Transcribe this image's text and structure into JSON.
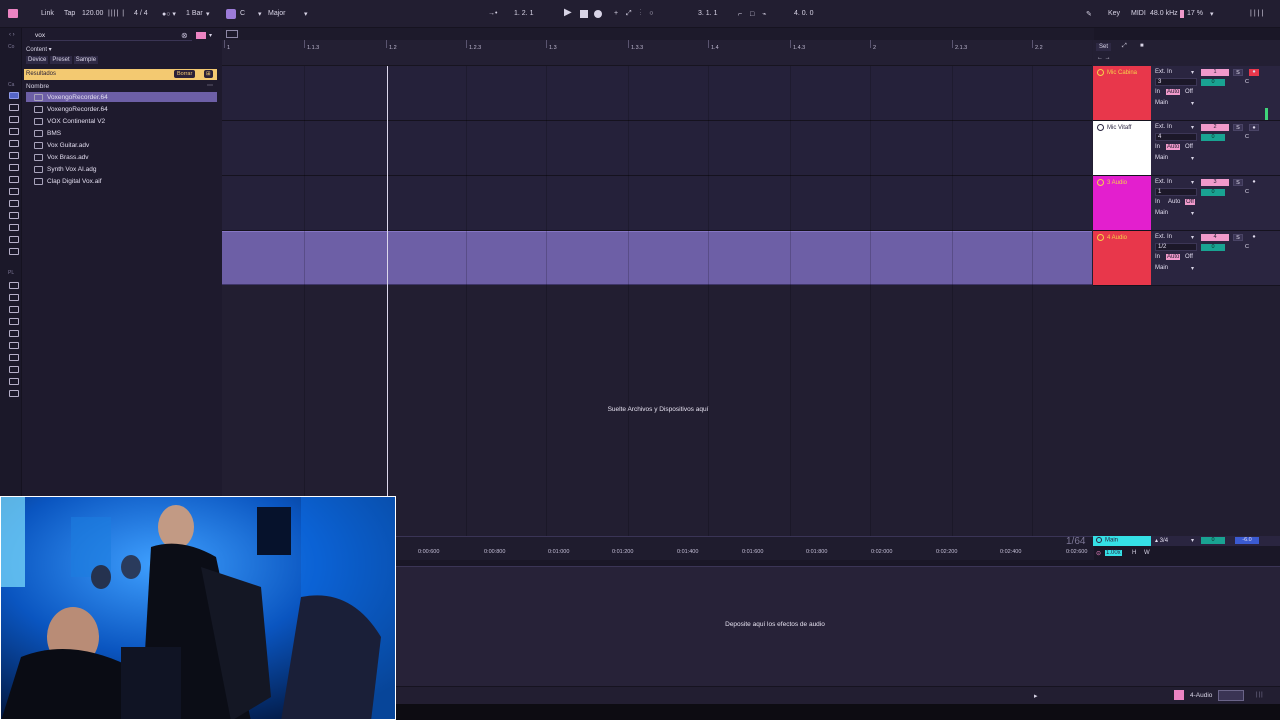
{
  "topbar": {
    "link": "Link",
    "tap": "Tap",
    "tempo": "120.00",
    "time_sig": "4 / 4",
    "quantize": "1 Bar",
    "key_root": "C",
    "scale": "Major",
    "arrangement_position": "1.   2.   1",
    "loop_start": "3.   1.   1",
    "loop_length": "4.   0.   0",
    "key_label": "Key",
    "midi_label": "MIDI",
    "sample_rate": "48.0 kHz",
    "cpu": "17 %"
  },
  "browser": {
    "search_value": "vox",
    "content_label": "Content",
    "filters": [
      "Device",
      "Preset",
      "Sample"
    ],
    "results_label": "Resultados",
    "clear_label": "Borrar",
    "column_header": "Nombre",
    "files": [
      "VoxengoRecorder.64",
      "VoxengoRecorder.64",
      "VOX Continental V2",
      "BMS",
      "Vox Guitar.adv",
      "Vox Brass.adv",
      "Synth Vox AI.adg",
      "Clap Digital Vox.aif"
    ],
    "side_labels": [
      "Co",
      "Ca",
      "PL"
    ]
  },
  "ruler": {
    "ticks": [
      "1",
      "1.1.3",
      "1.2",
      "1.2.3",
      "1.3",
      "1.3.3",
      "1.4",
      "1.4.3",
      "2",
      "2.1.3",
      "2.2"
    ]
  },
  "arrangement": {
    "drop_message": "Suelte Archivos y Dispositivos aquí",
    "zoom_label": "1/64",
    "timeline": [
      "0:00:600",
      "0:00:800",
      "0:01:000",
      "0:01:200",
      "0:01:400",
      "0:01:600",
      "0:01:800",
      "0:02:000",
      "0:02:200",
      "0:02:400",
      "0:02:600"
    ]
  },
  "mixer_header": {
    "set_label": "Set"
  },
  "tracks": [
    {
      "name": "Mic Cabina",
      "color": "#e8374b",
      "text_color": "#f5d14a",
      "input": "Ext. In",
      "channel": "3",
      "number": "1",
      "in": "In",
      "auto": "Auto",
      "off": "Off",
      "out": "Main",
      "solo": "S",
      "vol": "0",
      "pan": "C"
    },
    {
      "name": "Mic Vitaff",
      "color": "#ffffff",
      "text_color": "#2a2540",
      "input": "Ext. In",
      "channel": "4",
      "number": "2",
      "in": "In",
      "auto": "Auto",
      "off": "Off",
      "out": "Main",
      "solo": "S",
      "vol": "0",
      "pan": "C"
    },
    {
      "name": "3 Audio",
      "color": "#e31fce",
      "text_color": "#f5d14a",
      "input": "Ext. In",
      "channel": "1",
      "number": "3",
      "in": "In",
      "auto": "Auto",
      "off": "Off",
      "out": "Main",
      "solo": "S",
      "vol": "0",
      "pan": "C"
    },
    {
      "name": "4 Audio",
      "color": "#e8374b",
      "text_color": "#f5d14a",
      "input": "Ext. In",
      "channel": "1/2",
      "number": "4",
      "in": "In",
      "auto": "Auto",
      "off": "Off",
      "out": "Main",
      "solo": "S",
      "vol": "0",
      "pan": "C"
    }
  ],
  "main_track": {
    "name": "Main",
    "time_sig": "3/4",
    "vol": "0",
    "pan": "-6.0",
    "zoom": "1.00x",
    "h": "H",
    "w": "W"
  },
  "device_panel": {
    "drop_message": "Deposite aquí los efectos de audio",
    "selected_track": "4-Audio"
  },
  "colors": {
    "accent_pink": "#f09acb",
    "clip": "#6d5fa6",
    "teal": "#19a392",
    "main_track": "#35e0e6"
  }
}
